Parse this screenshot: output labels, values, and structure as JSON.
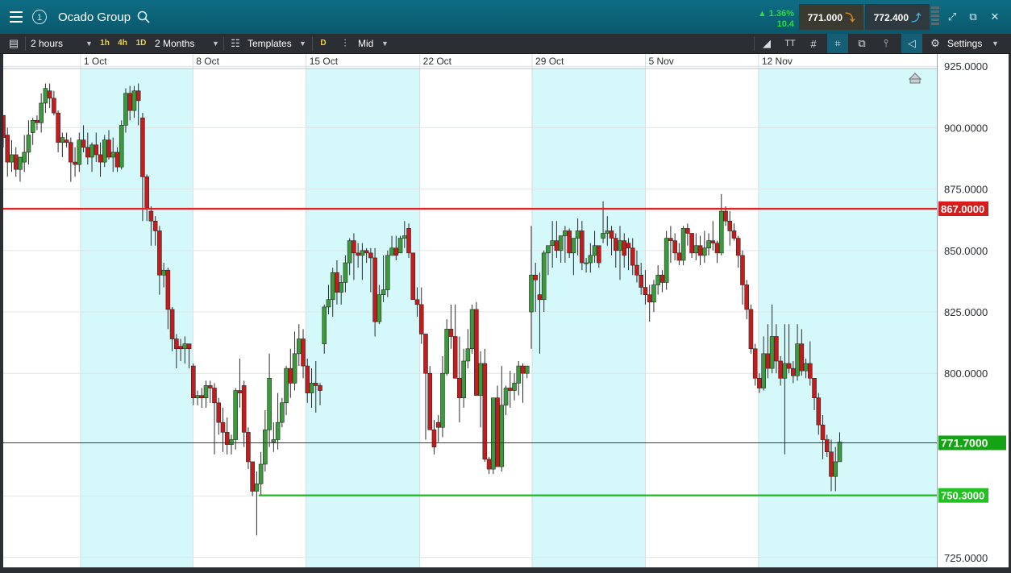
{
  "header": {
    "instrument": "Ocado Group",
    "window_number": "1",
    "change_percent": "1.36%",
    "change_abs": "10.4",
    "sell_price": "771.000",
    "buy_price": "772.400"
  },
  "toolbar": {
    "interval": "2 hours",
    "quick_1h": "1h",
    "quick_4h": "4h",
    "quick_1d": "1D",
    "range": "2 Months",
    "templates": "Templates",
    "mode_badge": "D",
    "price_type": "Mid",
    "text_tool": "TT",
    "settings": "Settings"
  },
  "colors": {
    "up": "#3b9a3b",
    "down": "#c41c1c",
    "resistance": "#e02424",
    "support": "#22c022",
    "weekend_band": "#d5f8fb",
    "current_tag": "#14a314",
    "resistance_tag": "#d41e1e"
  },
  "chart_data": {
    "type": "candlestick",
    "x_labels": [
      "1 Oct",
      "8 Oct",
      "15 Oct",
      "22 Oct",
      "29 Oct",
      "5 Nov",
      "12 Nov"
    ],
    "y_ticks": [
      "925.0000",
      "900.0000",
      "875.0000",
      "850.0000",
      "825.0000",
      "800.0000",
      "750.0000",
      "725.0000"
    ],
    "ylim": [
      721,
      930
    ],
    "xlim_bars": [
      0,
      221
    ],
    "week_start_bars": [
      18.3,
      44.9,
      71.7,
      98.6,
      125.2,
      152,
      178.8
    ],
    "lines": {
      "resistance": {
        "value": 867,
        "label": "867.0000"
      },
      "current": {
        "value": 771.7,
        "label": "771.7000"
      },
      "support": {
        "value": 750.3,
        "label": "750.3000",
        "from_bar": 60.5
      }
    },
    "candles": [
      [
        0,
        905,
        905,
        892,
        896
      ],
      [
        1,
        897,
        900,
        880,
        886
      ],
      [
        2,
        886,
        895,
        882,
        889
      ],
      [
        3,
        889,
        892,
        880,
        883
      ],
      [
        4,
        883,
        888,
        878,
        888
      ],
      [
        5,
        886,
        897,
        882,
        890
      ],
      [
        6,
        890,
        903,
        885,
        897
      ],
      [
        7,
        898,
        904,
        893,
        903
      ],
      [
        8,
        903,
        905,
        899,
        902
      ],
      [
        9,
        902,
        914,
        898,
        910
      ],
      [
        10,
        910,
        918,
        906,
        916
      ],
      [
        11,
        915,
        918,
        908,
        912
      ],
      [
        12,
        912,
        915,
        905,
        906
      ],
      [
        13,
        906,
        907,
        890,
        894
      ],
      [
        14,
        894,
        898,
        888,
        896
      ],
      [
        15,
        895,
        898,
        892,
        894
      ],
      [
        16,
        894,
        896,
        878,
        886
      ],
      [
        17,
        886,
        892,
        880,
        885
      ],
      [
        18,
        885,
        898,
        882,
        895
      ],
      [
        19,
        895,
        901,
        890,
        892
      ],
      [
        20,
        892,
        898,
        885,
        888
      ],
      [
        21,
        888,
        894,
        882,
        893
      ],
      [
        22,
        893,
        898,
        886,
        889
      ],
      [
        23,
        889,
        894,
        880,
        886
      ],
      [
        24,
        886,
        897,
        884,
        895
      ],
      [
        25,
        895,
        899,
        887,
        888
      ],
      [
        26,
        888,
        896,
        882,
        890
      ],
      [
        27,
        890,
        892,
        882,
        884
      ],
      [
        28,
        884,
        903,
        883,
        901
      ],
      [
        29,
        901,
        916,
        898,
        914
      ],
      [
        30,
        914,
        917,
        903,
        907
      ],
      [
        31,
        907,
        917,
        904,
        915
      ],
      [
        32,
        915,
        918,
        901,
        911
      ],
      [
        33,
        904,
        906,
        862,
        880
      ],
      [
        34,
        880,
        881,
        862,
        867
      ],
      [
        35,
        866,
        868,
        852,
        862
      ],
      [
        36,
        862,
        864,
        852,
        858
      ],
      [
        37,
        858,
        860,
        832,
        840
      ],
      [
        38,
        840,
        845,
        835,
        842
      ],
      [
        39,
        842,
        843,
        818,
        826
      ],
      [
        40,
        826,
        827,
        809,
        814
      ],
      [
        41,
        814,
        816,
        802,
        810
      ],
      [
        42,
        811,
        814,
        805,
        810
      ],
      [
        43,
        810,
        815,
        804,
        812
      ],
      [
        44,
        812,
        811,
        802,
        810
      ],
      [
        45,
        803,
        804,
        787,
        790
      ],
      [
        46,
        790,
        793,
        787,
        791
      ],
      [
        47,
        791,
        794,
        786,
        790
      ],
      [
        48,
        790,
        797,
        786,
        795
      ],
      [
        49,
        795,
        797,
        788,
        794
      ],
      [
        50,
        794,
        796,
        767,
        788
      ],
      [
        51,
        788,
        790,
        775,
        780
      ],
      [
        52,
        780,
        786,
        768,
        776
      ],
      [
        53,
        776,
        782,
        767,
        771
      ],
      [
        54,
        771,
        775,
        767,
        773
      ],
      [
        55,
        773,
        794,
        769,
        793
      ],
      [
        56,
        793,
        806,
        786,
        792
      ],
      [
        57,
        795,
        797,
        770,
        776
      ],
      [
        58,
        776,
        778,
        761,
        764
      ],
      [
        59,
        764,
        764,
        750,
        752
      ],
      [
        60,
        752,
        760,
        734,
        755
      ],
      [
        61,
        755,
        768,
        750,
        763
      ],
      [
        62,
        763,
        785,
        760,
        777
      ],
      [
        63,
        777,
        808,
        770,
        798
      ],
      [
        64,
        772,
        780,
        768,
        773
      ],
      [
        65,
        773,
        792,
        769,
        780
      ],
      [
        66,
        780,
        790,
        778,
        788
      ],
      [
        67,
        788,
        803,
        783,
        802
      ],
      [
        68,
        802,
        810,
        790,
        796
      ],
      [
        69,
        796,
        817,
        793,
        808
      ],
      [
        70,
        808,
        820,
        803,
        814
      ],
      [
        71,
        814,
        818,
        798,
        803
      ],
      [
        72,
        803,
        806,
        788,
        792
      ],
      [
        73,
        792,
        802,
        786,
        796
      ],
      [
        74,
        796,
        805,
        784,
        795
      ],
      [
        75,
        795,
        796,
        787,
        793
      ],
      [
        76,
        812,
        828,
        808,
        827
      ],
      [
        77,
        827,
        836,
        824,
        830
      ],
      [
        78,
        830,
        843,
        823,
        841
      ],
      [
        79,
        841,
        846,
        828,
        833
      ],
      [
        80,
        833,
        840,
        828,
        837
      ],
      [
        81,
        837,
        848,
        833,
        845
      ],
      [
        82,
        845,
        855,
        840,
        854
      ],
      [
        83,
        854,
        857,
        838,
        849
      ],
      [
        84,
        849,
        853,
        843,
        848
      ],
      [
        85,
        848,
        853,
        838,
        850
      ],
      [
        86,
        850,
        851,
        845,
        849
      ],
      [
        87,
        849,
        851,
        833,
        847
      ],
      [
        88,
        847,
        851,
        815,
        821
      ],
      [
        89,
        821,
        836,
        820,
        832
      ],
      [
        90,
        832,
        848,
        829,
        834
      ],
      [
        91,
        834,
        850,
        831,
        848
      ],
      [
        92,
        848,
        856,
        848,
        851
      ],
      [
        93,
        851,
        856,
        846,
        848
      ],
      [
        94,
        849,
        856,
        850,
        855
      ],
      [
        95,
        855,
        862,
        851,
        856
      ],
      [
        96,
        859,
        861,
        847,
        849
      ],
      [
        97,
        849,
        849,
        835,
        830
      ],
      [
        98,
        830,
        835,
        823,
        828
      ],
      [
        99,
        828,
        835,
        812,
        816
      ],
      [
        100,
        816,
        816,
        773,
        800
      ],
      [
        101,
        800,
        803,
        779,
        777
      ],
      [
        102,
        777,
        781,
        767,
        770
      ],
      [
        103,
        780,
        783,
        772,
        778
      ],
      [
        104,
        778,
        807,
        774,
        800
      ],
      [
        105,
        800,
        822,
        799,
        818
      ],
      [
        106,
        818,
        828,
        810,
        815
      ],
      [
        107,
        815,
        828,
        806,
        798
      ],
      [
        108,
        798,
        815,
        780,
        790
      ],
      [
        109,
        790,
        810,
        786,
        805
      ],
      [
        110,
        805,
        818,
        802,
        810
      ],
      [
        111,
        810,
        828,
        808,
        826
      ],
      [
        112,
        826,
        829,
        796,
        791
      ],
      [
        113,
        791,
        809,
        778,
        804
      ],
      [
        114,
        804,
        810,
        764,
        765
      ],
      [
        115,
        765,
        766,
        759,
        761
      ],
      [
        116,
        761,
        790,
        759,
        790
      ],
      [
        117,
        790,
        795,
        762,
        762
      ],
      [
        118,
        762,
        803,
        760,
        787
      ],
      [
        119,
        787,
        795,
        783,
        794
      ],
      [
        120,
        794,
        801,
        786,
        793
      ],
      [
        121,
        793,
        800,
        789,
        796
      ],
      [
        122,
        796,
        805,
        791,
        803
      ],
      [
        123,
        803,
        804,
        788,
        800
      ],
      [
        124,
        800,
        803,
        798,
        803
      ],
      [
        125,
        825,
        860,
        810,
        840
      ],
      [
        126,
        840,
        845,
        825,
        838
      ],
      [
        127,
        832,
        841,
        808,
        830
      ],
      [
        128,
        830,
        850,
        825,
        849
      ],
      [
        129,
        849,
        852,
        840,
        852
      ],
      [
        130,
        852,
        862,
        843,
        854
      ],
      [
        131,
        854,
        862,
        847,
        850
      ],
      [
        132,
        850,
        855,
        845,
        856
      ],
      [
        133,
        856,
        860,
        845,
        858
      ],
      [
        134,
        858,
        859,
        847,
        849
      ],
      [
        135,
        849,
        855,
        840,
        855
      ],
      [
        136,
        855,
        863,
        848,
        858
      ],
      [
        137,
        858,
        862,
        842,
        845
      ],
      [
        138,
        845,
        847,
        841,
        845
      ],
      [
        139,
        845,
        853,
        841,
        848
      ],
      [
        140,
        848,
        858,
        845,
        852
      ],
      [
        141,
        852,
        852,
        843,
        845
      ],
      [
        142,
        855,
        870,
        853,
        857
      ],
      [
        143,
        857,
        864,
        852,
        858
      ],
      [
        144,
        858,
        860,
        848,
        855
      ],
      [
        145,
        855,
        857,
        843,
        850
      ],
      [
        146,
        850,
        860,
        838,
        854
      ],
      [
        147,
        854,
        857,
        843,
        848
      ],
      [
        148,
        853,
        855,
        842,
        851
      ],
      [
        149,
        851,
        855,
        840,
        844
      ],
      [
        150,
        844,
        850,
        837,
        840
      ],
      [
        151,
        840,
        845,
        832,
        835
      ],
      [
        152,
        835,
        842,
        828,
        832
      ],
      [
        153,
        832,
        836,
        821,
        829
      ],
      [
        154,
        829,
        838,
        825,
        836
      ],
      [
        155,
        836,
        844,
        832,
        840
      ],
      [
        156,
        840,
        842,
        833,
        837
      ],
      [
        157,
        837,
        858,
        834,
        855
      ],
      [
        158,
        855,
        860,
        845,
        854
      ],
      [
        159,
        854,
        857,
        846,
        849
      ],
      [
        160,
        849,
        853,
        844,
        846
      ],
      [
        161,
        846,
        860,
        844,
        859
      ],
      [
        162,
        859,
        861,
        852,
        857
      ],
      [
        163,
        857,
        857,
        847,
        849
      ],
      [
        164,
        849,
        857,
        846,
        852
      ],
      [
        165,
        852,
        856,
        844,
        848
      ],
      [
        166,
        848,
        858,
        845,
        851
      ],
      [
        167,
        851,
        857,
        848,
        854
      ],
      [
        168,
        854,
        862,
        850,
        853
      ],
      [
        169,
        853,
        854,
        845,
        849
      ],
      [
        170,
        849,
        873,
        848,
        866
      ],
      [
        171,
        866,
        868,
        860,
        862
      ],
      [
        172,
        862,
        866,
        852,
        858
      ],
      [
        173,
        858,
        861,
        854,
        855
      ],
      [
        174,
        855,
        856,
        843,
        848
      ],
      [
        175,
        848,
        850,
        828,
        836
      ],
      [
        176,
        836,
        838,
        822,
        826
      ],
      [
        177,
        826,
        828,
        808,
        810
      ],
      [
        178,
        810,
        812,
        795,
        798
      ],
      [
        179,
        798,
        800,
        792,
        794
      ],
      [
        180,
        794,
        815,
        793,
        808
      ],
      [
        181,
        808,
        820,
        798,
        802
      ],
      [
        182,
        802,
        828,
        800,
        815
      ],
      [
        183,
        815,
        820,
        800,
        805
      ],
      [
        184,
        805,
        807,
        795,
        798
      ],
      [
        185,
        798,
        820,
        767,
        804
      ],
      [
        186,
        804,
        820,
        800,
        802
      ],
      [
        187,
        802,
        805,
        796,
        799
      ],
      [
        188,
        799,
        820,
        797,
        812
      ],
      [
        189,
        812,
        818,
        799,
        801
      ],
      [
        190,
        801,
        806,
        798,
        804
      ],
      [
        191,
        804,
        813,
        795,
        798
      ],
      [
        192,
        798,
        797,
        785,
        790
      ],
      [
        193,
        790,
        792,
        775,
        779
      ],
      [
        194,
        779,
        783,
        765,
        773
      ],
      [
        195,
        773,
        775,
        766,
        768
      ],
      [
        196,
        768,
        773,
        752,
        758
      ],
      [
        197,
        758,
        770,
        752,
        764
      ],
      [
        198,
        764,
        776,
        767,
        772
      ]
    ]
  }
}
